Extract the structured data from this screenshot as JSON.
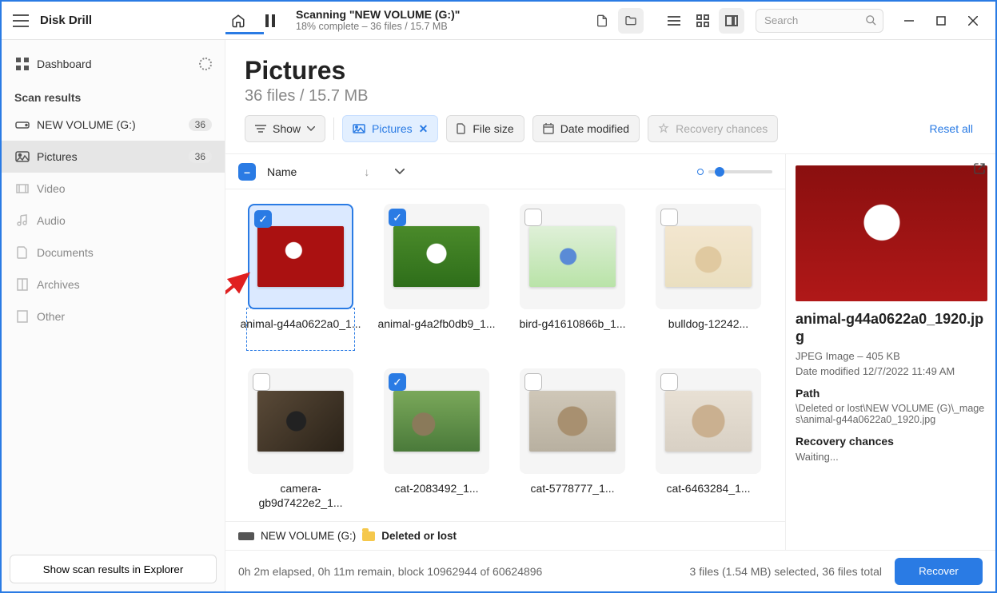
{
  "app": {
    "title": "Disk Drill"
  },
  "status": {
    "title": "Scanning \"NEW VOLUME (G:)\"",
    "sub": "18% complete – 36 files / 15.7 MB"
  },
  "search": {
    "placeholder": "Search"
  },
  "sidebar": {
    "dashboard": "Dashboard",
    "heading": "Scan results",
    "items": [
      {
        "label": "NEW VOLUME (G:)",
        "badge": "36"
      },
      {
        "label": "Pictures",
        "badge": "36"
      },
      {
        "label": "Video"
      },
      {
        "label": "Audio"
      },
      {
        "label": "Documents"
      },
      {
        "label": "Archives"
      },
      {
        "label": "Other"
      }
    ],
    "footer_btn": "Show scan results in Explorer"
  },
  "header": {
    "title": "Pictures",
    "sub": "36 files / 15.7 MB"
  },
  "filters": {
    "show": "Show",
    "pictures": "Pictures",
    "filesize": "File size",
    "datemod": "Date modified",
    "recovery": "Recovery chances",
    "reset": "Reset all"
  },
  "columns": {
    "name": "Name"
  },
  "files": [
    {
      "name": "animal-g44a0622a0_1...",
      "checked": true,
      "selected": true,
      "thumb": "t-dogred"
    },
    {
      "name": "animal-g4a2fb0db9_1...",
      "checked": true,
      "thumb": "t-doggrass"
    },
    {
      "name": "bird-g41610866b_1...",
      "checked": false,
      "thumb": "t-bird"
    },
    {
      "name": "bulldog-12242...",
      "checked": false,
      "thumb": "t-bulldog"
    },
    {
      "name": "camera-gb9d7422e2_1...",
      "checked": false,
      "thumb": "t-camera"
    },
    {
      "name": "cat-2083492_1...",
      "checked": true,
      "thumb": "t-cat1"
    },
    {
      "name": "cat-5778777_1...",
      "checked": false,
      "thumb": "t-cat2"
    },
    {
      "name": "cat-6463284_1...",
      "checked": false,
      "thumb": "t-cat3"
    }
  ],
  "breadcrumb": {
    "drive": "NEW VOLUME (G:)",
    "folder": "Deleted or lost"
  },
  "preview": {
    "filename": "animal-g44a0622a0_1920.jpg",
    "meta": "JPEG Image – 405 KB",
    "date": "Date modified 12/7/2022 11:49 AM",
    "path_h": "Path",
    "path": "\\Deleted or lost\\NEW VOLUME (G)\\_mages\\animal-g44a0622a0_1920.jpg",
    "rec_h": "Recovery chances",
    "rec": "Waiting..."
  },
  "footer": {
    "elapsed": "0h 2m elapsed, 0h 11m remain, block 10962944 of 60624896",
    "selection": "3 files (1.54 MB) selected, 36 files total",
    "recover": "Recover"
  }
}
